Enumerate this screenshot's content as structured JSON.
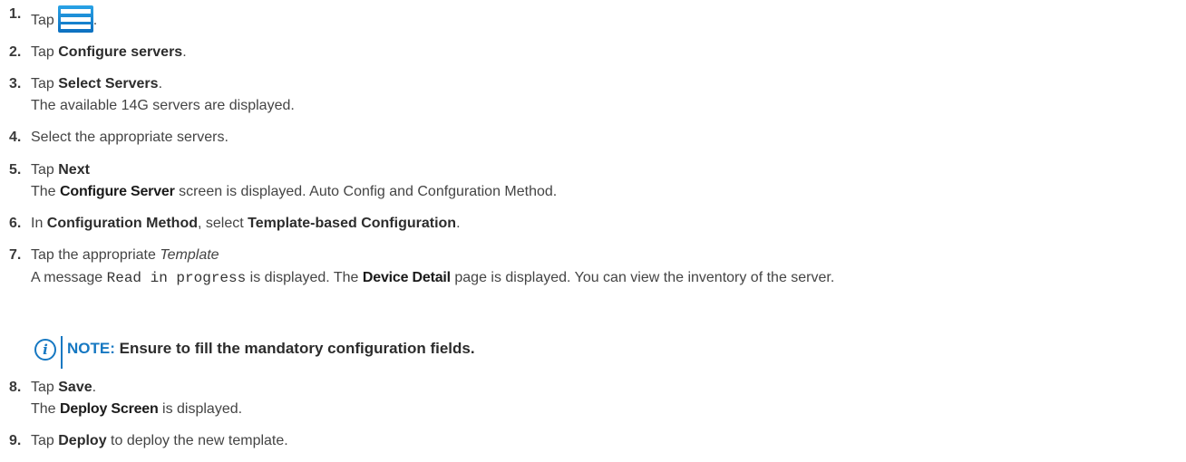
{
  "steps": [
    {
      "num": "1.",
      "pre": "Tap",
      "icon": "hamburger-menu-icon",
      "post": "."
    },
    {
      "num": "2.",
      "pre": "Tap ",
      "bold": "Configure servers",
      "post": "."
    },
    {
      "num": "3.",
      "pre": "Tap ",
      "bold": "Select Servers",
      "post": ".",
      "result": "The available 14G servers are displayed."
    },
    {
      "num": "4.",
      "text": "Select the appropriate servers."
    },
    {
      "num": "5.",
      "pre": "Tap ",
      "bold": "Next",
      "result_bold": "Configure Server",
      "result_pre": "The ",
      "result_post": " screen is displayed. Auto Config and Confguration Method."
    },
    {
      "num": "6.",
      "pre": "In ",
      "bold": "Configuration Method",
      "mid": ", select ",
      "bold2": "Template-based Configuration",
      "post": "."
    },
    {
      "num": "7.",
      "pre": "Tap the appropriate ",
      "italic": "Template",
      "result_a": "A message ",
      "result_code": "Read in progress",
      "result_b": " is displayed. The ",
      "result_bold": "Device Detail",
      "result_c": " page is displayed. You can view the inventory of the server."
    },
    {
      "num": "8.",
      "pre": "Tap ",
      "bold": "Save",
      "post": ".",
      "result_pre": "The ",
      "result_bold": "Deploy Screen",
      "result_post": " is displayed."
    },
    {
      "num": "9.",
      "pre": "Tap ",
      "bold": "Deploy",
      "post": " to deploy the new template."
    }
  ],
  "note": {
    "label": "NOTE:",
    "text": " Ensure to fill the mandatory configuration fields.",
    "icon": "info-icon"
  },
  "colors": {
    "accent": "#1678c2",
    "icon_blue": "#1a86d6"
  }
}
